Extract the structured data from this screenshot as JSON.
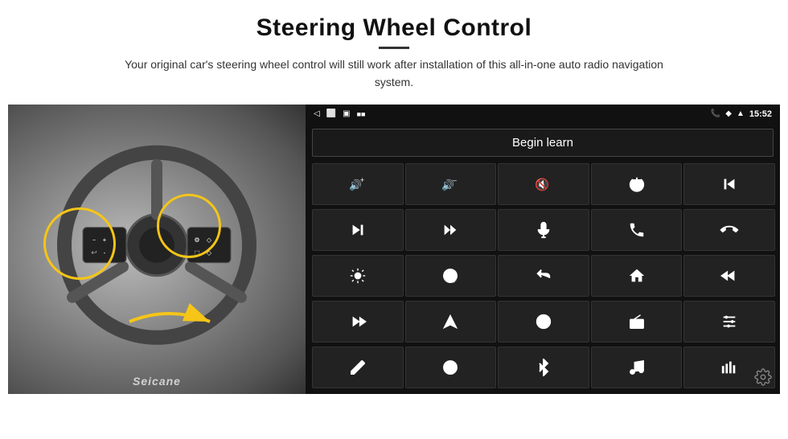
{
  "header": {
    "title": "Steering Wheel Control",
    "divider": true,
    "subtitle": "Your original car's steering wheel control will still work after installation of this all-in-one auto radio navigation system."
  },
  "status_bar": {
    "left_icons": [
      "◁",
      "⬜",
      "▣",
      "■■"
    ],
    "right_icons": [
      "📞",
      "◆",
      "WiFi"
    ],
    "time": "15:52"
  },
  "begin_learn": {
    "label": "Begin learn"
  },
  "controls": [
    {
      "icon": "vol_up",
      "symbol": "🔊+"
    },
    {
      "icon": "vol_down",
      "symbol": "🔊–"
    },
    {
      "icon": "mute",
      "symbol": "🔇"
    },
    {
      "icon": "power",
      "symbol": "⏻"
    },
    {
      "icon": "prev_track",
      "symbol": "⏮"
    },
    {
      "icon": "next_track",
      "symbol": "⏭"
    },
    {
      "icon": "prev_prev",
      "symbol": "⏭|"
    },
    {
      "icon": "mic",
      "symbol": "🎤"
    },
    {
      "icon": "phone",
      "symbol": "📞"
    },
    {
      "icon": "hang_up",
      "symbol": "📵"
    },
    {
      "icon": "brightness",
      "symbol": "☀"
    },
    {
      "icon": "360_view",
      "symbol": "👁"
    },
    {
      "icon": "back",
      "symbol": "↩"
    },
    {
      "icon": "home",
      "symbol": "⌂"
    },
    {
      "icon": "skip_back",
      "symbol": "⏮"
    },
    {
      "icon": "skip_fwd",
      "symbol": "⏭"
    },
    {
      "icon": "nav",
      "symbol": "◄"
    },
    {
      "icon": "swap",
      "symbol": "⇄"
    },
    {
      "icon": "radio",
      "symbol": "📻"
    },
    {
      "icon": "equalizer",
      "symbol": "≡"
    },
    {
      "icon": "pen",
      "symbol": "✏"
    },
    {
      "icon": "record",
      "symbol": "⏺"
    },
    {
      "icon": "bluetooth",
      "symbol": "Ⓑ"
    },
    {
      "icon": "music",
      "symbol": "♫"
    },
    {
      "icon": "bar_chart",
      "symbol": "📊"
    }
  ],
  "watermark": "Seicane",
  "gear_icon": "⚙"
}
